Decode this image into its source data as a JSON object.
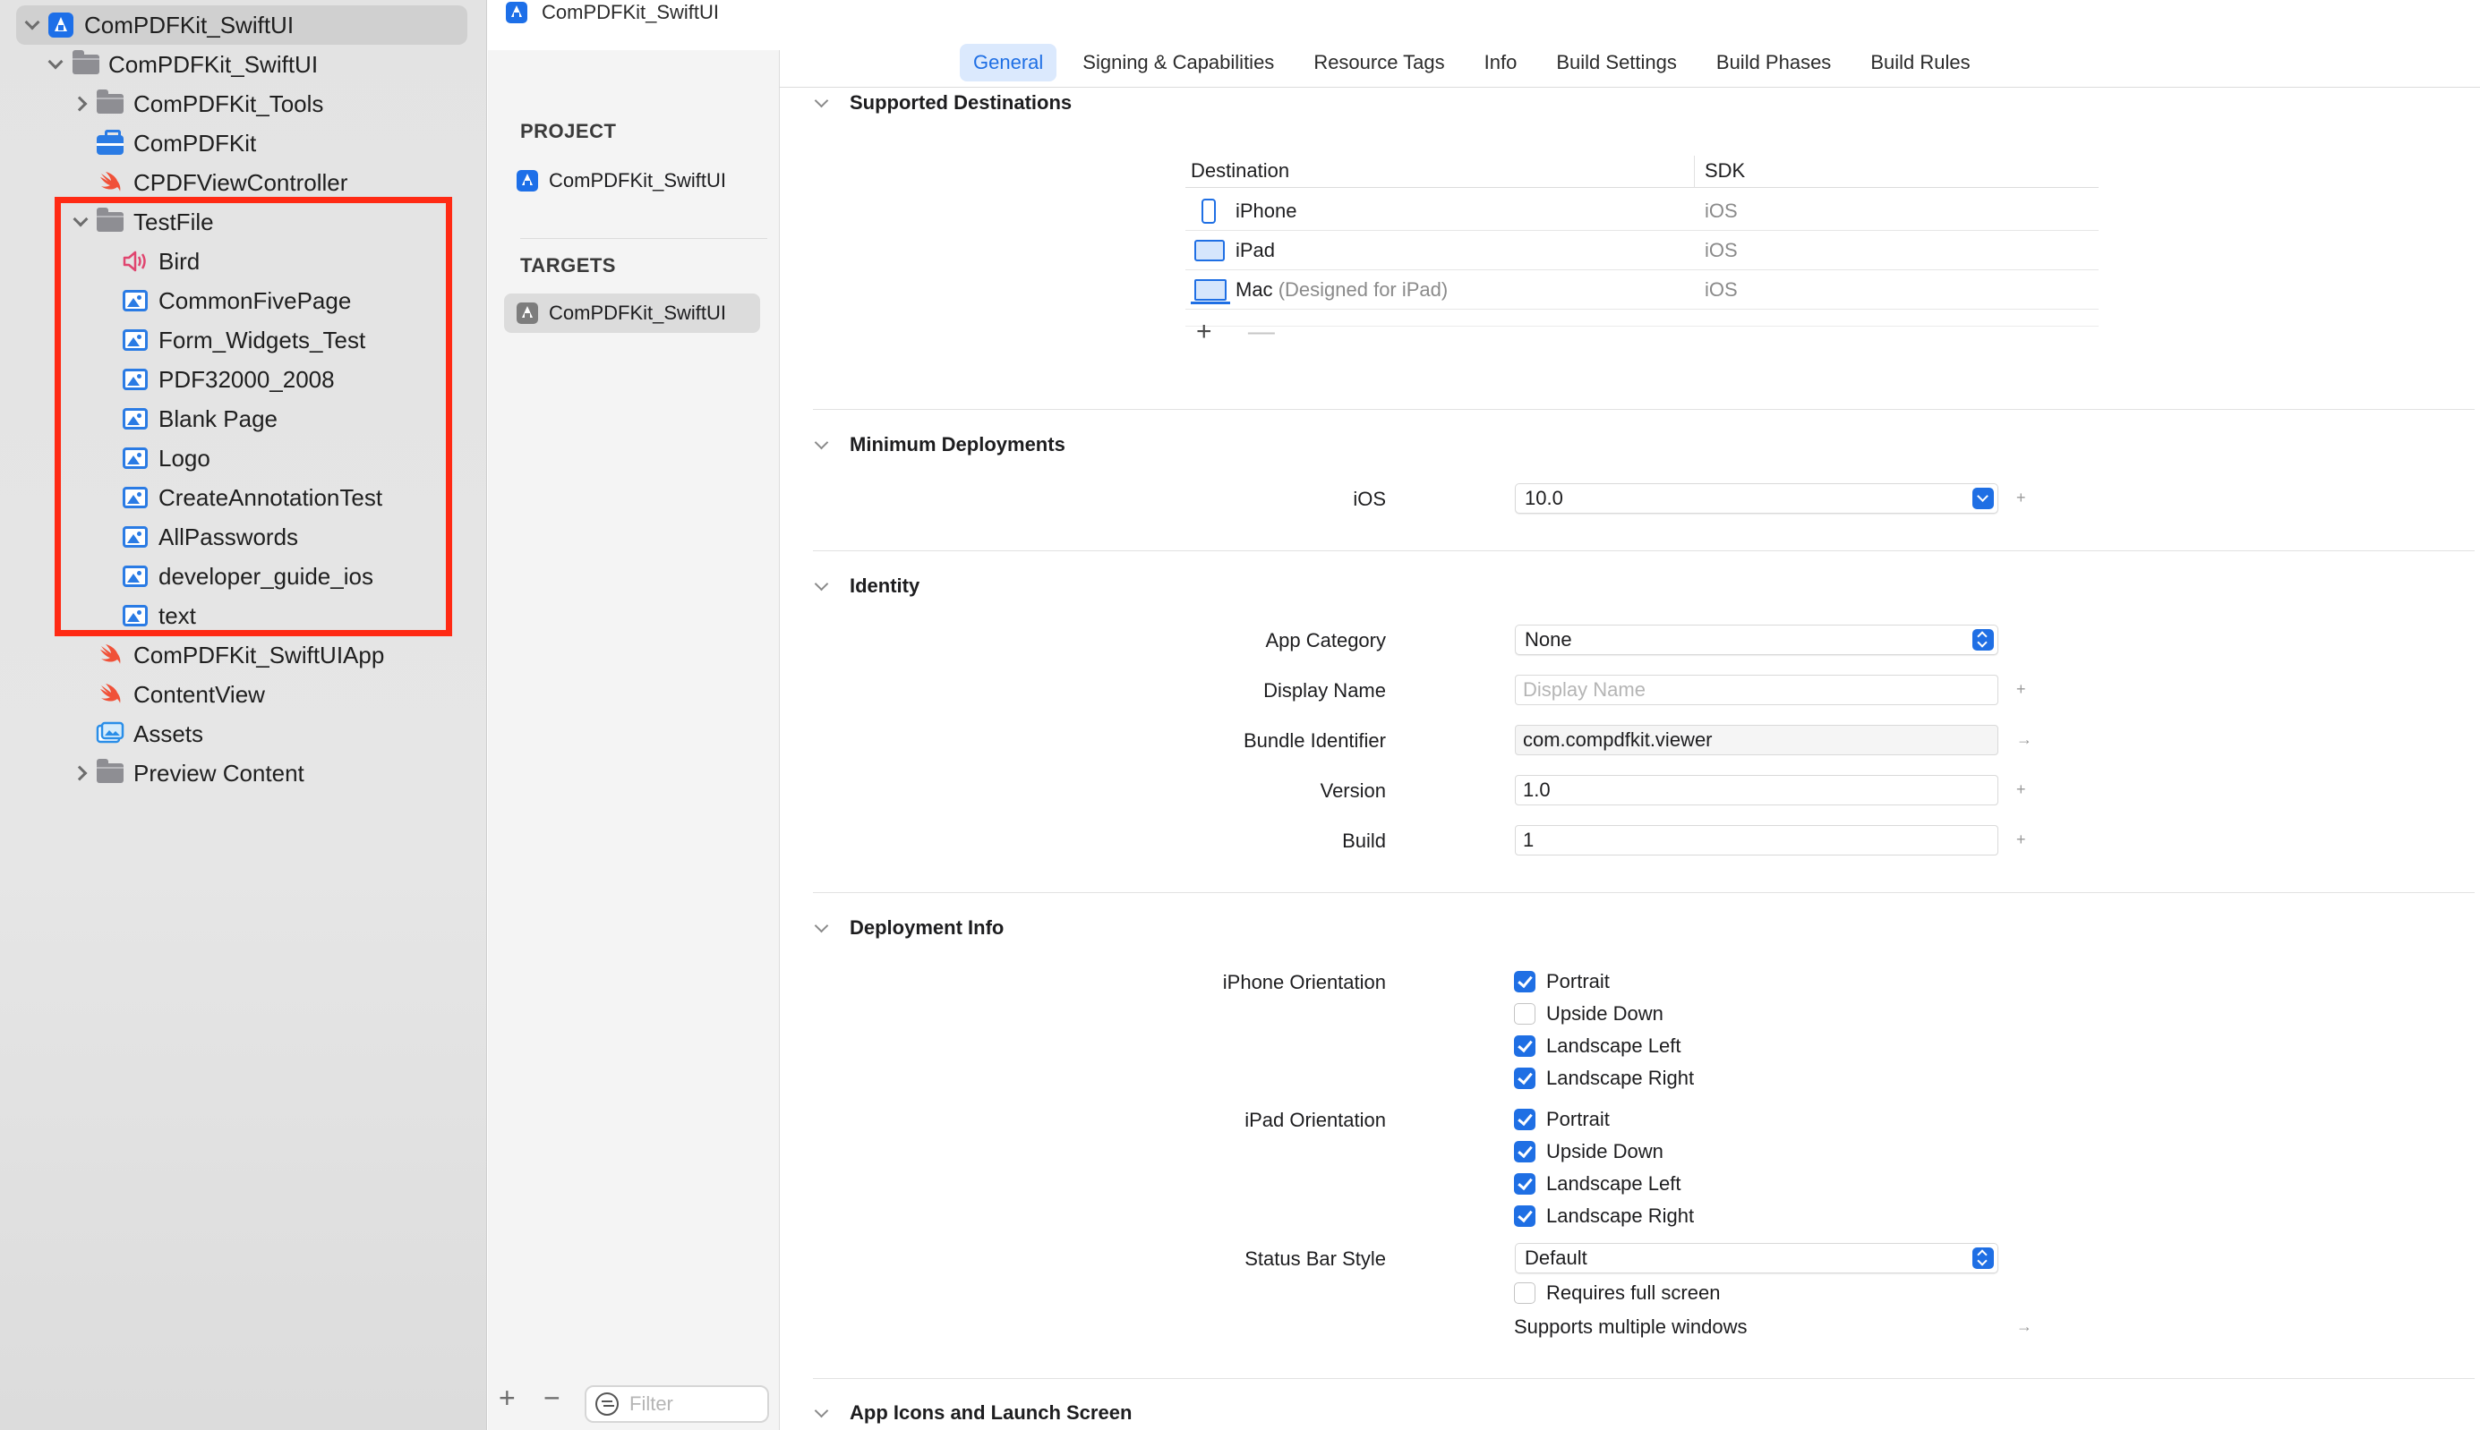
{
  "navigator": {
    "items": [
      {
        "label": "ComPDFKit_SwiftUI",
        "icon": "app-icon",
        "expanded": true
      },
      {
        "label": "ComPDFKit_SwiftUI",
        "icon": "folder-icon",
        "expanded": true
      },
      {
        "label": "ComPDFKit_Tools",
        "icon": "folder-icon",
        "expanded": false
      },
      {
        "label": "ComPDFKit",
        "icon": "toolbox-icon"
      },
      {
        "label": "CPDFViewController",
        "icon": "swift-icon"
      },
      {
        "label": "TestFile",
        "icon": "folder-icon",
        "expanded": true
      },
      {
        "label": "Bird",
        "icon": "sound-icon"
      },
      {
        "label": "CommonFivePage",
        "icon": "image-icon"
      },
      {
        "label": "Form_Widgets_Test",
        "icon": "image-icon"
      },
      {
        "label": "PDF32000_2008",
        "icon": "image-icon"
      },
      {
        "label": "Blank Page",
        "icon": "image-icon"
      },
      {
        "label": "Logo",
        "icon": "image-icon"
      },
      {
        "label": "CreateAnnotationTest",
        "icon": "image-icon"
      },
      {
        "label": "AllPasswords",
        "icon": "image-icon"
      },
      {
        "label": "developer_guide_ios",
        "icon": "image-icon"
      },
      {
        "label": "text",
        "icon": "image-icon"
      },
      {
        "label": "ComPDFKit_SwiftUIApp",
        "icon": "swift-icon"
      },
      {
        "label": "ContentView",
        "icon": "swift-icon"
      },
      {
        "label": "Assets",
        "icon": "assets-icon"
      },
      {
        "label": "Preview Content",
        "icon": "folder-icon",
        "expanded": false
      }
    ]
  },
  "breadcrumb": {
    "label": "ComPDFKit_SwiftUI"
  },
  "tabs": [
    {
      "label": "General",
      "active": true
    },
    {
      "label": "Signing & Capabilities"
    },
    {
      "label": "Resource Tags"
    },
    {
      "label": "Info"
    },
    {
      "label": "Build Settings"
    },
    {
      "label": "Build Phases"
    },
    {
      "label": "Build Rules"
    }
  ],
  "project_column": {
    "project_header": "PROJECT",
    "project_item": "ComPDFKit_SwiftUI",
    "targets_header": "TARGETS",
    "target_item": "ComPDFKit_SwiftUI",
    "add_glyph": "+",
    "remove_glyph": "−",
    "filter_placeholder": "Filter"
  },
  "sections": {
    "supported_destinations": {
      "title": "Supported Destinations",
      "col_destination": "Destination",
      "col_sdk": "SDK",
      "rows": [
        {
          "name": "iPhone",
          "suffix": "",
          "sdk": "iOS",
          "icon": "iphone-icon"
        },
        {
          "name": "iPad",
          "suffix": "",
          "sdk": "iOS",
          "icon": "ipad-icon"
        },
        {
          "name": "Mac",
          "suffix": "(Designed for iPad)",
          "sdk": "iOS",
          "icon": "mac-icon"
        }
      ],
      "add_glyph": "+",
      "remove_glyph": "—"
    },
    "minimum_deployments": {
      "title": "Minimum Deployments",
      "ios_label": "iOS",
      "ios_value": "10.0"
    },
    "identity": {
      "title": "Identity",
      "app_category_label": "App Category",
      "app_category_value": "None",
      "display_name_label": "Display Name",
      "display_name_placeholder": "Display Name",
      "bundle_identifier_label": "Bundle Identifier",
      "bundle_identifier_value": "com.compdfkit.viewer",
      "version_label": "Version",
      "version_value": "1.0",
      "build_label": "Build",
      "build_value": "1"
    },
    "deployment_info": {
      "title": "Deployment Info",
      "iphone_orientation_label": "iPhone Orientation",
      "iphone_orientations": [
        {
          "label": "Portrait",
          "checked": true
        },
        {
          "label": "Upside Down",
          "checked": false
        },
        {
          "label": "Landscape Left",
          "checked": true
        },
        {
          "label": "Landscape Right",
          "checked": true
        }
      ],
      "ipad_orientation_label": "iPad Orientation",
      "ipad_orientations": [
        {
          "label": "Portrait",
          "checked": true
        },
        {
          "label": "Upside Down",
          "checked": true
        },
        {
          "label": "Landscape Left",
          "checked": true
        },
        {
          "label": "Landscape Right",
          "checked": true
        }
      ],
      "status_bar_style_label": "Status Bar Style",
      "status_bar_style_value": "Default",
      "requires_full_screen_label": "Requires full screen",
      "requires_full_screen_checked": false,
      "supports_multiple_windows_label": "Supports multiple windows"
    },
    "app_icons": {
      "title": "App Icons and Launch Screen"
    }
  },
  "glyphs": {
    "plus": "+",
    "arrow": "→"
  },
  "colors": {
    "accent": "#1f6fe4",
    "highlight": "#ff2a14",
    "sidebar": "#e4e4e4"
  }
}
